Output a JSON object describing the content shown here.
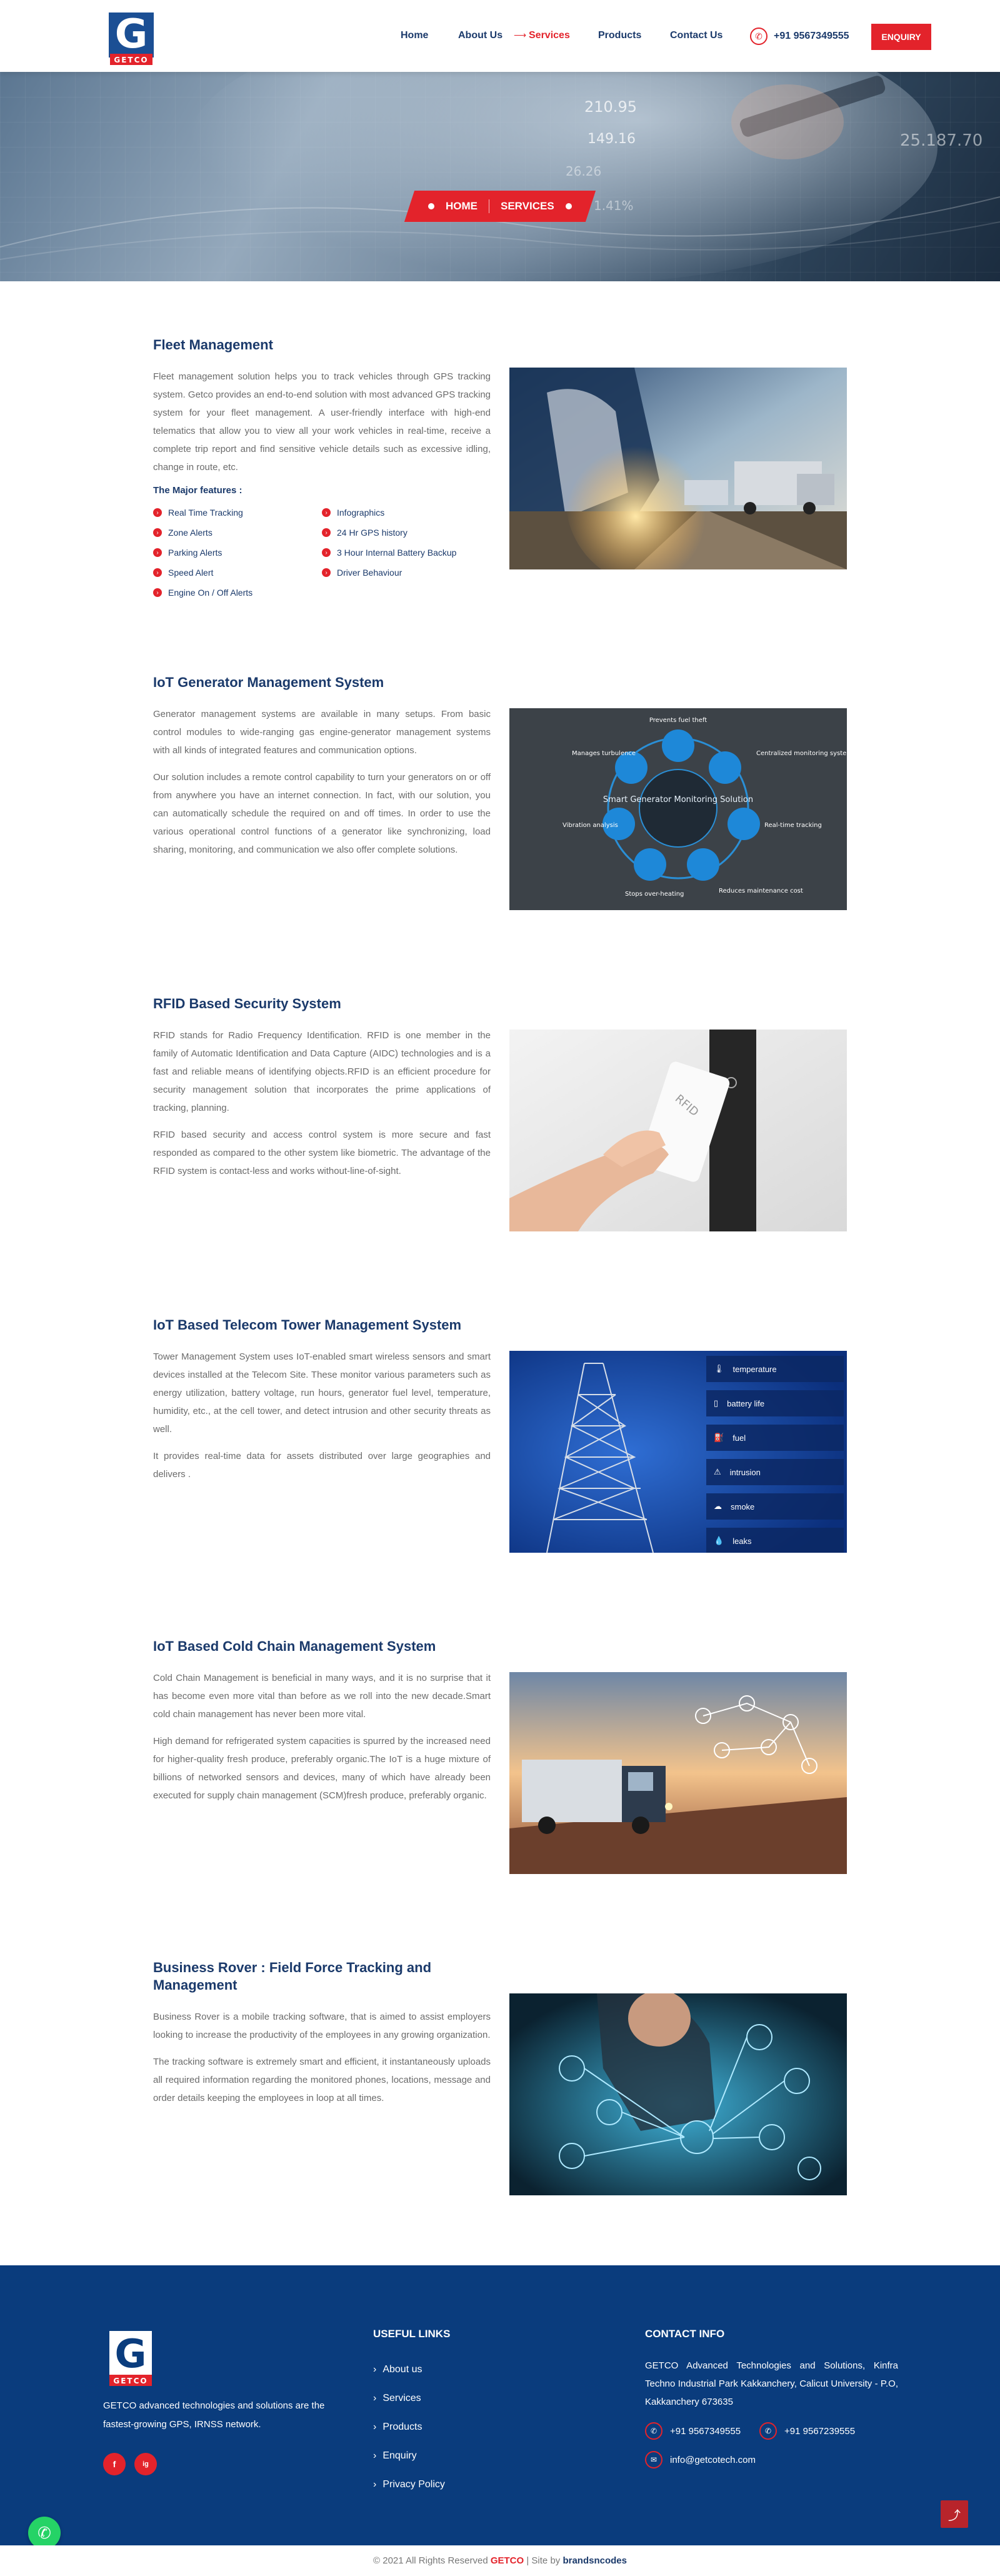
{
  "brand": {
    "name": "GETCO",
    "logo_letter": "G"
  },
  "nav": {
    "items": [
      "Home",
      "About Us",
      "Services",
      "Products",
      "Contact Us"
    ],
    "active": "Services",
    "phone": "+91 9567349555",
    "enquiry": "ENQUIRY"
  },
  "hero": {
    "crumbs": [
      "HOME",
      "SERVICES"
    ],
    "tickers": [
      "210.95",
      "149.16",
      "26.26",
      "1.41%",
      "25.187.70"
    ]
  },
  "sections": [
    {
      "title": "Fleet Management",
      "paragraphs": [
        "Fleet management solution helps you to track vehicles through GPS tracking system. Getco provides an end-to-end solution with most advanced GPS tracking system for your fleet management. A user-friendly interface with high-end telematics that allow you to view all your work vehicles in real-time, receive a complete trip report and find sensitive vehicle details such as excessive idling, change in route, etc."
      ],
      "features_title": "The Major features :",
      "features": [
        "Real Time Tracking",
        "Infographics",
        "Zone Alerts",
        "24 Hr GPS history",
        "Parking Alerts",
        "3 Hour Internal Battery Backup",
        "Speed Alert",
        "Driver Behaviour",
        "Engine On / Off Alerts"
      ],
      "image": "fleet-trucks-image"
    },
    {
      "title": "IoT Generator Management System",
      "paragraphs": [
        "Generator management systems are available in many setups. From basic control modules to wide-ranging gas engine-generator management systems with all kinds of integrated features and communication options.",
        "Our solution includes a remote control capability to turn your generators on or off from anywhere you have an internet connection. In fact, with our solution, you can automatically schedule the required on and off times. In order to use the various operational control functions of a generator like synchronizing, load sharing, monitoring, and communication we also offer complete solutions."
      ],
      "image": "generator-monitoring-image",
      "diagram": {
        "center": "Smart Generator Monitoring Solution",
        "labels": [
          "Prevents fuel theft",
          "Centralized monitoring system",
          "Real-time tracking",
          "Reduces maintenance cost",
          "Stops over-heating",
          "Vibration analysis",
          "Manages turbulence"
        ]
      }
    },
    {
      "title": "RFID Based Security System",
      "paragraphs": [
        "RFID stands for Radio Frequency Identification. RFID is one member in the family of Automatic Identification and Data Capture (AIDC) technologies and is a fast and reliable means of identifying objects.RFID is an efficient procedure for security management solution that incorporates the prime applications of tracking, planning.",
        "RFID based security and access control system is more secure and fast responded as compared to the other system like biometric. The advantage of the RFID system is contact-less and works without-line-of-sight."
      ],
      "image": "rfid-card-image",
      "card_text": "RFID"
    },
    {
      "title": "IoT Based Telecom Tower Management System",
      "paragraphs": [
        "Tower Management System uses IoT-enabled smart wireless sensors and smart devices installed at the Telecom Site. These monitor various parameters such as energy utilization, battery voltage, run hours, generator fuel level, temperature, humidity, etc., at the cell tower, and detect intrusion and other security threats as well.",
        "It provides real-time data for assets distributed over large geographies and delivers ."
      ],
      "image": "telecom-tower-image",
      "sensors": [
        "temperature",
        "battery life",
        "fuel",
        "intrusion",
        "smoke",
        "leaks"
      ]
    },
    {
      "title": "IoT Based Cold Chain Management System",
      "paragraphs": [
        "Cold Chain Management is beneficial in many ways, and it is no surprise that it has become even more vital than before as we roll into the new decade.Smart cold chain management has never been more vital.",
        "High demand for refrigerated system capacities is spurred by the increased need for higher-quality fresh produce, preferably organic.The IoT is a huge mixture of billions of networked sensors and devices, many of which have already been executed for supply chain management (SCM)fresh produce, preferably organic."
      ],
      "image": "cold-chain-truck-image"
    },
    {
      "title": "Business Rover : Field Force Tracking and Management",
      "paragraphs": [
        "Business Rover is a mobile tracking software, that is aimed to assist employers looking to increase the productivity of the employees in any growing organization.",
        "The tracking software is extremely smart and efficient, it instantaneously uploads all required information regarding the monitored phones, locations, message and order details keeping the employees in loop at all times."
      ],
      "image": "field-force-network-image"
    }
  ],
  "footer": {
    "description": "GETCO advanced technologies and solutions are the fastest-growing GPS, IRNSS network.",
    "social": [
      "f",
      "ig"
    ],
    "links_title": "USEFUL LINKS",
    "links": [
      "About us",
      "Services",
      "Products",
      "Enquiry",
      "Privacy Policy"
    ],
    "contact_title": "CONTACT INFO",
    "address": "GETCO Advanced Technologies and Solutions, Kinfra Techno Industrial Park Kakkanchery, Calicut University - P.O, Kakkanchery 673635",
    "phones": [
      "+91 9567349555",
      "+91 9567239555"
    ],
    "email": "info@getcotech.com"
  },
  "copyright": {
    "prefix": "© 2021 All Rights Reserved",
    "brand": "GETCO",
    "mid": "| Site by",
    "agency": "brandsncodes"
  },
  "colors": {
    "accent": "#e3232b",
    "navy": "#1b3a6b",
    "footer": "#0a3c7d"
  }
}
